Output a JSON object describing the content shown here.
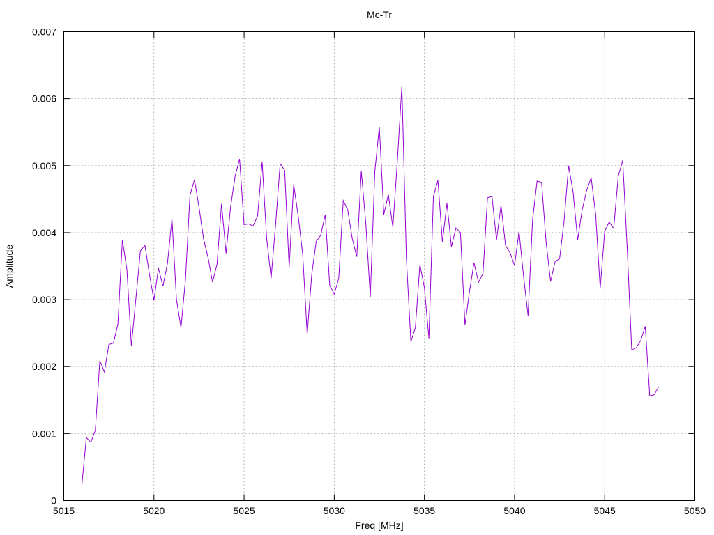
{
  "chart_data": {
    "type": "line",
    "title": "Mc-Tr",
    "xlabel": "Freq [MHz]",
    "ylabel": "Amplitude",
    "xlim": [
      5015,
      5050
    ],
    "ylim": [
      0,
      0.007
    ],
    "xticks": [
      "5015",
      "5020",
      "5025",
      "5030",
      "5035",
      "5040",
      "5045",
      "5050"
    ],
    "yticks": [
      "0",
      "0.001",
      "0.002",
      "0.003",
      "0.004",
      "0.005",
      "0.006",
      "0.007"
    ],
    "grid": true,
    "legend": "none",
    "series": [
      {
        "color": "#9400d3",
        "x": [
          5016.0,
          5016.25,
          5016.5,
          5016.75,
          5017.0,
          5017.25,
          5017.5,
          5017.75,
          5018.0,
          5018.25,
          5018.5,
          5018.75,
          5019.0,
          5019.25,
          5019.5,
          5019.75,
          5020.0,
          5020.25,
          5020.5,
          5020.75,
          5021.0,
          5021.25,
          5021.5,
          5021.75,
          5022.0,
          5022.25,
          5022.5,
          5022.75,
          5023.0,
          5023.25,
          5023.5,
          5023.75,
          5024.0,
          5024.25,
          5024.5,
          5024.75,
          5025.0,
          5025.25,
          5025.5,
          5025.75,
          5026.0,
          5026.25,
          5026.5,
          5026.75,
          5027.0,
          5027.25,
          5027.5,
          5027.75,
          5028.0,
          5028.25,
          5028.5,
          5028.75,
          5029.0,
          5029.25,
          5029.5,
          5029.75,
          5030.0,
          5030.25,
          5030.5,
          5030.75,
          5031.0,
          5031.25,
          5031.5,
          5031.75,
          5032.0,
          5032.25,
          5032.5,
          5032.75,
          5033.0,
          5033.25,
          5033.5,
          5033.75,
          5034.0,
          5034.25,
          5034.5,
          5034.75,
          5035.0,
          5035.25,
          5035.5,
          5035.75,
          5036.0,
          5036.25,
          5036.5,
          5036.75,
          5037.0,
          5037.25,
          5037.5,
          5037.75,
          5038.0,
          5038.25,
          5038.5,
          5038.75,
          5039.0,
          5039.25,
          5039.5,
          5039.75,
          5040.0,
          5040.25,
          5040.5,
          5040.75,
          5041.0,
          5041.25,
          5041.5,
          5041.75,
          5042.0,
          5042.25,
          5042.5,
          5042.75,
          5043.0,
          5043.25,
          5043.5,
          5043.75,
          5044.0,
          5044.25,
          5044.5,
          5044.75,
          5045.0,
          5045.25,
          5045.5,
          5045.75,
          5046.0,
          5046.25,
          5046.5,
          5046.75,
          5047.0,
          5047.25,
          5047.5,
          5047.75,
          5048.0
        ],
        "y": [
          0.00022,
          0.00094,
          0.00087,
          0.00105,
          0.00209,
          0.00192,
          0.00233,
          0.00235,
          0.00263,
          0.00389,
          0.00345,
          0.00231,
          0.00302,
          0.00373,
          0.00381,
          0.00338,
          0.00299,
          0.00347,
          0.0032,
          0.00354,
          0.00421,
          0.003,
          0.00258,
          0.0033,
          0.00456,
          0.00479,
          0.00438,
          0.00391,
          0.00363,
          0.00326,
          0.00353,
          0.00443,
          0.00369,
          0.00438,
          0.00484,
          0.0051,
          0.00412,
          0.00413,
          0.0041,
          0.00425,
          0.00506,
          0.00392,
          0.00332,
          0.00413,
          0.00503,
          0.00493,
          0.00348,
          0.00472,
          0.00425,
          0.00368,
          0.00248,
          0.00337,
          0.00387,
          0.00396,
          0.00427,
          0.00321,
          0.00308,
          0.00332,
          0.00448,
          0.00434,
          0.00391,
          0.00364,
          0.00492,
          0.00414,
          0.00304,
          0.00491,
          0.00558,
          0.00427,
          0.00457,
          0.00408,
          0.00507,
          0.00619,
          0.00362,
          0.00237,
          0.00258,
          0.00352,
          0.00318,
          0.00242,
          0.00454,
          0.00478,
          0.00386,
          0.00444,
          0.00379,
          0.00407,
          0.004,
          0.00262,
          0.00312,
          0.00355,
          0.00326,
          0.00339,
          0.00452,
          0.00454,
          0.00389,
          0.00441,
          0.00381,
          0.0037,
          0.00351,
          0.00402,
          0.00335,
          0.00276,
          0.00419,
          0.00477,
          0.00475,
          0.00386,
          0.00327,
          0.00357,
          0.00361,
          0.00418,
          0.005,
          0.0046,
          0.00389,
          0.00434,
          0.00463,
          0.00482,
          0.00427,
          0.00317,
          0.00402,
          0.00416,
          0.00406,
          0.00484,
          0.00508,
          0.00376,
          0.00225,
          0.00228,
          0.00239,
          0.0026,
          0.00156,
          0.00158,
          0.0017
        ]
      }
    ]
  }
}
